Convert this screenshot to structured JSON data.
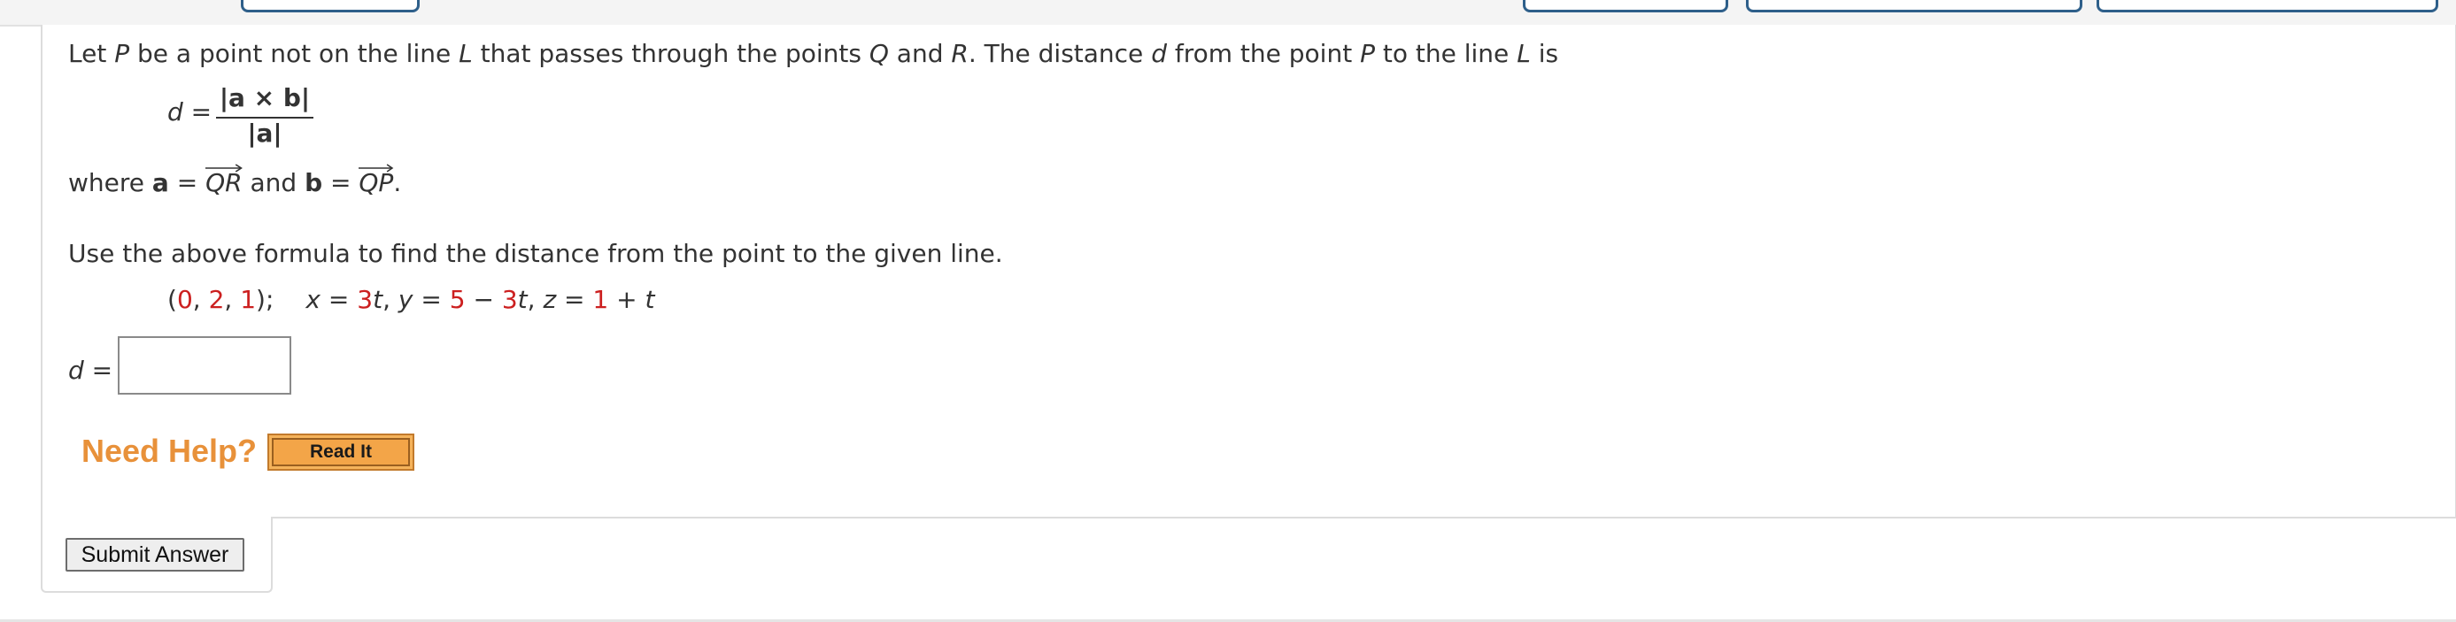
{
  "problem": {
    "intro": {
      "p1": "Let ",
      "P": "P",
      "p2": " be a point not on the line ",
      "L": "L",
      "p3": " that passes through the points ",
      "Q": "Q",
      "p4": " and ",
      "R": "R",
      "p5": ". The distance ",
      "d": "d",
      "p6": " from the point ",
      "P2": "P",
      "p7": " to the line ",
      "L2": "L",
      "p8": " is"
    },
    "formula": {
      "lhs_var": "d",
      "lhs_eq": " =",
      "numerator": "|a × b|",
      "denominator": "|a|"
    },
    "where_line": {
      "w1": "where  ",
      "a": "a",
      "eq1": " = ",
      "QR": "QR",
      "and": " and ",
      "b": "b",
      "eq2": " = ",
      "QP": "QP",
      "end": "."
    },
    "instruction": "Use the above formula to find the distance from the point to the given line.",
    "given": {
      "open": "(",
      "px": "0",
      "c1": ", ",
      "py": "2",
      "c2": ", ",
      "pz": "1",
      "close": ");",
      "x": "x",
      "xeq": " = ",
      "xc": "3",
      "t1": "t",
      "sep1": ", ",
      "y": "y",
      "yeq": " = ",
      "yc": "5",
      "minus": " − ",
      "yk": "3",
      "t2": "t",
      "sep2": ", ",
      "z": "z",
      "zeq": " = ",
      "zc": "1",
      "plus": " + ",
      "t3": "t"
    },
    "answer": {
      "label_var": "d",
      "label_eq": " =",
      "value": ""
    }
  },
  "help": {
    "need_help": "Need Help?",
    "read_it": "Read It"
  },
  "submit_label": "Submit Answer",
  "colors": {
    "highlight_number": "#cc2020",
    "need_help": "#e8913a",
    "read_it_button": "#f3a548",
    "tab_border": "#2e5f8a"
  }
}
